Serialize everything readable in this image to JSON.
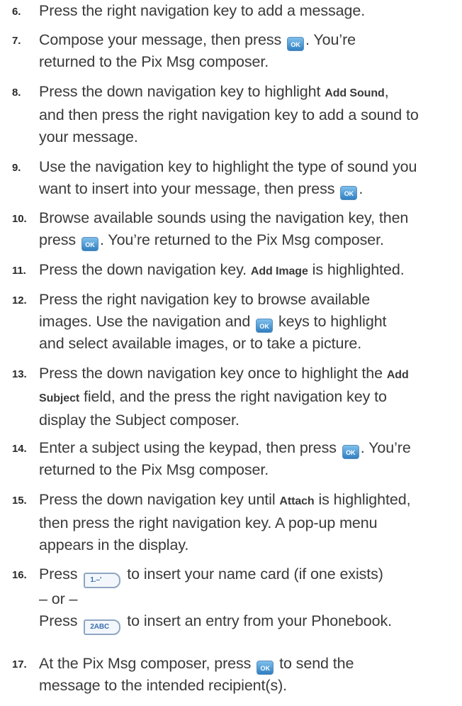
{
  "steps": [
    {
      "num": "6.",
      "lines": [
        "Press the right navigation key to add a message."
      ]
    },
    {
      "num": "7.",
      "l1a": "Compose your message, then press",
      "l1b": ". You’re",
      "l2": "returned to the Pix Msg composer."
    },
    {
      "num": "8.",
      "l1a": "Press the down navigation key to highlight ",
      "l1bold": "Add Sound",
      "l1b": ",",
      "l2": "and then press the right navigation key to add a sound to",
      "l3": "your message."
    },
    {
      "num": "9.",
      "l1": "Use the navigation key to highlight the type of sound you",
      "l2a": "want to insert into your message, then press",
      "l2b": "."
    },
    {
      "num": "10.",
      "l1": "Browse available sounds using the navigation key, then",
      "l2a": "press",
      "l2b": ". You’re returned to the Pix Msg composer."
    },
    {
      "num": "11.",
      "l1a": "Press the down navigation key. ",
      "l1bold": "Add Image",
      "l1b": " is highlighted."
    },
    {
      "num": "12.",
      "l1": "Press the right navigation key to browse available",
      "l2a": "images. Use the navigation and",
      "l2b": "keys to highlight",
      "l3": "and select available images, or to take a picture."
    },
    {
      "num": "13.",
      "l1a": "Press the down navigation key once to highlight the ",
      "l1bold": "Add",
      "l2bold": "Subject",
      "l2a": " field, and the press the right navigation key to",
      "l3": "display the Subject composer."
    },
    {
      "num": "14.",
      "l1a": "Enter a subject using the keypad, then press",
      "l1b": ". You’re",
      "l2": "returned to the Pix Msg composer."
    },
    {
      "num": "15.",
      "l1a": "Press the down navigation key until ",
      "l1bold": "Attach",
      "l1b": " is highlighted,",
      "l2": "then press the right navigation key. A pop-up menu",
      "l3": "appears in the display."
    },
    {
      "num": "16.",
      "l1a": "Press",
      "l1b": "to insert your name card (if one exists)",
      "l2": "– or –",
      "l3a": "Press",
      "l3b": "to insert an entry from your Phonebook."
    },
    {
      "num": "17.",
      "l1a": "At the Pix Msg composer, press",
      "l1b": "to send the",
      "l2": "message to the intended recipient(s)."
    }
  ],
  "keys": {
    "ok": "OK",
    "key1": "1.–'",
    "key2": "2ABC"
  }
}
